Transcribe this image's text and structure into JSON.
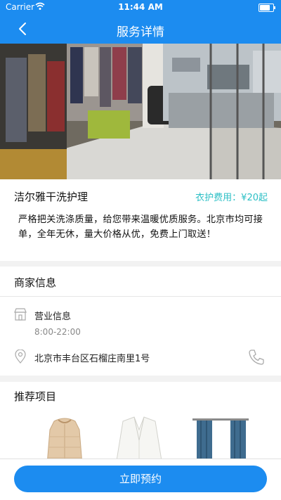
{
  "status_bar": {
    "carrier": "Carrier",
    "time": "11:44 AM"
  },
  "nav": {
    "title": "服务详情"
  },
  "colors": {
    "primary": "#1c8cf0",
    "accent": "#2bbfc5",
    "dot_active": "#1c8cf0",
    "dot_inactive": "#ffffff"
  },
  "carousel": {
    "image": "laundry-shop-interior-photo",
    "page_count": 2,
    "active_index": 0
  },
  "service": {
    "name": "洁尔雅干洗护理",
    "fee_label": "衣护费用：",
    "fee_value": "¥20起",
    "description": "严格把关洗涤质量，给您带来温暖优质服务。北京市均可接单，全年无休，量大价格从优，免费上门取送！"
  },
  "merchant": {
    "section_title": "商家信息",
    "business_label": "营业信息",
    "business_hours": "8:00-22:00",
    "address": "北京市丰台区石榴庄南里1号",
    "icons": [
      "store-icon",
      "location-icon",
      "phone-icon"
    ]
  },
  "recommend": {
    "section_title": "推荐项目",
    "items": [
      "down-jacket",
      "white-blazer",
      "blue-curtains"
    ]
  },
  "bottom": {
    "book_label": "立即预约"
  }
}
